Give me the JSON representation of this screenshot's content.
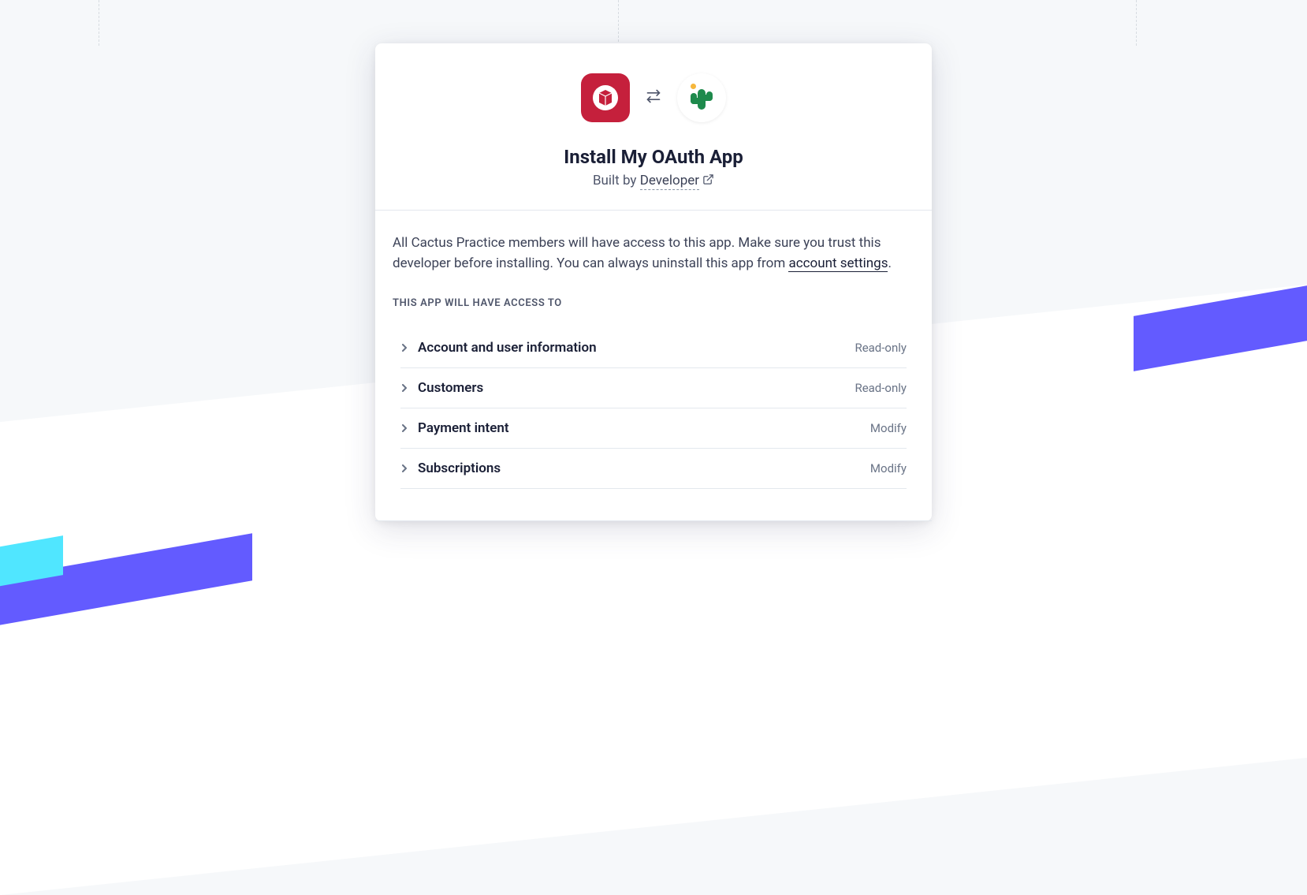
{
  "header": {
    "title": "Install My OAuth App",
    "built_by_prefix": "Built by ",
    "developer_link_text": "Developer"
  },
  "body": {
    "description_prefix": "All Cactus Practice members will have access to this app. Make sure you trust this developer before installing. You can always uninstall this app from ",
    "settings_link_text": "account settings",
    "description_suffix": ".",
    "section_label": "THIS APP WILL HAVE ACCESS TO"
  },
  "permissions": [
    {
      "name": "Account and user information",
      "level": "Read-only"
    },
    {
      "name": "Customers",
      "level": "Read-only"
    },
    {
      "name": "Payment intent",
      "level": "Modify"
    },
    {
      "name": "Subscriptions",
      "level": "Modify"
    }
  ]
}
